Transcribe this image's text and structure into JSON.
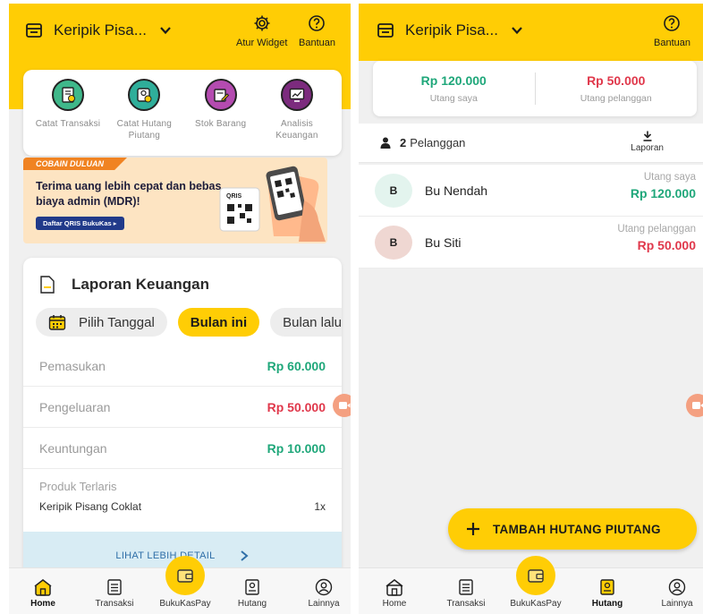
{
  "colors": {
    "brand_yellow": "#ffcd05",
    "green": "#1fa77a",
    "red": "#e0384b",
    "link_blue": "#2f6fa8"
  },
  "left": {
    "header": {
      "shop_name": "Keripik Pisa...",
      "settings_label": "Atur Widget",
      "help_label": "Bantuan"
    },
    "quick_actions": [
      {
        "label": "Catat Transaksi",
        "icon": "receipt-icon",
        "color": "#3fb88a"
      },
      {
        "label": "Catat Hutang Piutang",
        "icon": "debt-note-icon",
        "color": "#2fae9a"
      },
      {
        "label": "Stok Barang",
        "icon": "stock-icon",
        "color": "#b44bb0"
      },
      {
        "label": "Analisis Keuangan",
        "icon": "analytics-icon",
        "color": "#7c2b7e"
      }
    ],
    "banner": {
      "tag": "COBAIN DULUAN",
      "headline": "Terima uang lebih cepat dan bebas biaya admin (MDR)!",
      "button": "Daftar QRIS BukuKas ▸",
      "qris_label": "QRIS"
    },
    "report": {
      "title": "Laporan Keuangan",
      "chips": [
        "Pilih Tanggal",
        "Bulan ini",
        "Bulan lalu"
      ],
      "selected_chip": "Bulan ini",
      "rows": [
        {
          "label": "Pemasukan",
          "value": "Rp 60.000"
        },
        {
          "label": "Pengeluaran",
          "value": "Rp 50.000"
        },
        {
          "label": "Keuntungan",
          "value": "Rp 10.000"
        }
      ],
      "best_seller": {
        "title": "Produk Terlaris",
        "product": "Keripik Pisang Coklat",
        "qty": "1x"
      },
      "detail_link": "LIHAT LEBIH DETAIL"
    },
    "nav": [
      "Home",
      "Transaksi",
      "BukuKasPay",
      "Hutang",
      "Lainnya"
    ],
    "active_nav": "Home"
  },
  "right": {
    "header": {
      "shop_name": "Keripik Pisa...",
      "help_label": "Bantuan"
    },
    "summary": [
      {
        "value": "Rp 120.000",
        "label": "Utang saya"
      },
      {
        "value": "Rp 50.000",
        "label": "Utang pelanggan"
      }
    ],
    "customer_count": "2",
    "customer_label": "Pelanggan",
    "report_label": "Laporan",
    "customers": [
      {
        "initial": "B",
        "name": "Bu Nendah",
        "status": "Utang saya",
        "amount": "Rp 120.000",
        "avatar_color": "#e3f4ee"
      },
      {
        "initial": "B",
        "name": "Bu Siti",
        "status": "Utang pelanggan",
        "amount": "Rp 50.000",
        "avatar_color": "#efd7d2"
      }
    ],
    "fab_label": "TAMBAH HUTANG PIUTANG",
    "nav": [
      "Home",
      "Transaksi",
      "BukuKasPay",
      "Hutang",
      "Lainnya"
    ],
    "active_nav": "Hutang"
  }
}
